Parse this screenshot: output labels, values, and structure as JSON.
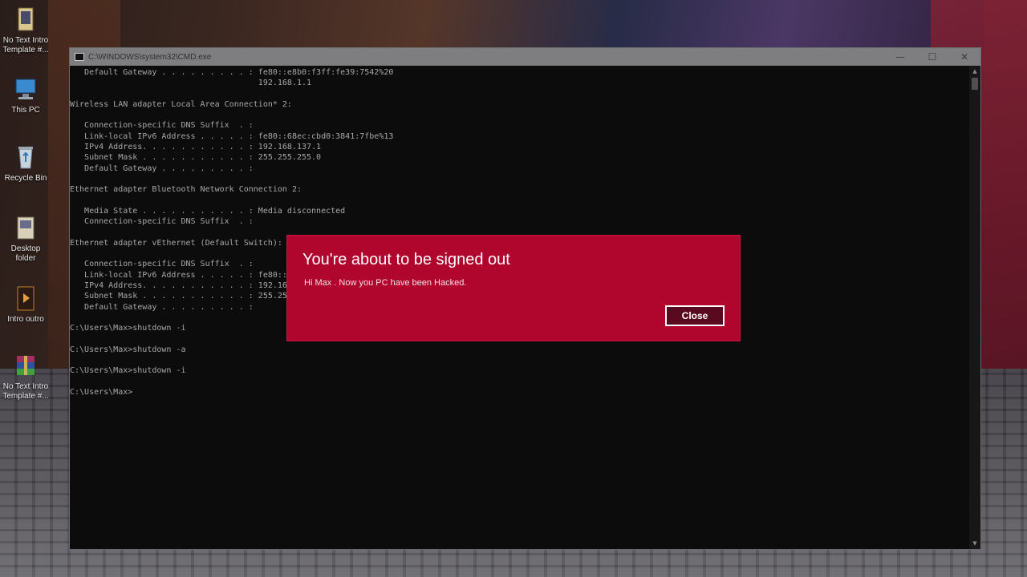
{
  "desktop": {
    "icons": [
      {
        "label_line1": "No Text Intro",
        "label_line2": "Template #...",
        "icon": "folder-document-icon"
      },
      {
        "label_line1": "This PC",
        "label_line2": "",
        "icon": "computer-icon"
      },
      {
        "label_line1": "Recycle Bin",
        "label_line2": "",
        "icon": "recycle-bin-icon"
      },
      {
        "label_line1": "Desktop",
        "label_line2": "folder",
        "icon": "folder-icon"
      },
      {
        "label_line1": "Intro outro",
        "label_line2": "",
        "icon": "video-file-icon"
      },
      {
        "label_line1": "No Text Intro",
        "label_line2": "Template #...",
        "icon": "winrar-archive-icon"
      }
    ]
  },
  "cmd": {
    "title": "C:\\WINDOWS\\system32\\CMD.exe",
    "minimize": "—",
    "maximize": "☐",
    "close": "✕",
    "lines": [
      "   Default Gateway . . . . . . . . . : fe80::e8b0:f3ff:fe39:7542%20",
      "                                       192.168.1.1",
      "",
      "Wireless LAN adapter Local Area Connection* 2:",
      "",
      "   Connection-specific DNS Suffix  . :",
      "   Link-local IPv6 Address . . . . . : fe80::68ec:cbd0:3841:7fbe%13",
      "   IPv4 Address. . . . . . . . . . . : 192.168.137.1",
      "   Subnet Mask . . . . . . . . . . . : 255.255.255.0",
      "   Default Gateway . . . . . . . . . :",
      "",
      "Ethernet adapter Bluetooth Network Connection 2:",
      "",
      "   Media State . . . . . . . . . . . : Media disconnected",
      "   Connection-specific DNS Suffix  . :",
      "",
      "Ethernet adapter vEthernet (Default Switch):",
      "",
      "   Connection-specific DNS Suffix  . :",
      "   Link-local IPv6 Address . . . . . : fe80::",
      "   IPv4 Address. . . . . . . . . . . : 192.16",
      "   Subnet Mask . . . . . . . . . . . : 255.25",
      "   Default Gateway . . . . . . . . . :",
      "",
      "C:\\Users\\Max>shutdown -i",
      "",
      "C:\\Users\\Max>shutdown -a",
      "",
      "C:\\Users\\Max>shutdown -i",
      "",
      "C:\\Users\\Max>"
    ]
  },
  "dialog": {
    "title": "You're about to be signed out",
    "message": "Hi Max . Now you PC have been Hacked.",
    "close_label": "Close"
  },
  "colors": {
    "dialog_bg": "#b0052d",
    "console_bg": "#0c0c0c",
    "console_text": "#a8a8a8"
  }
}
